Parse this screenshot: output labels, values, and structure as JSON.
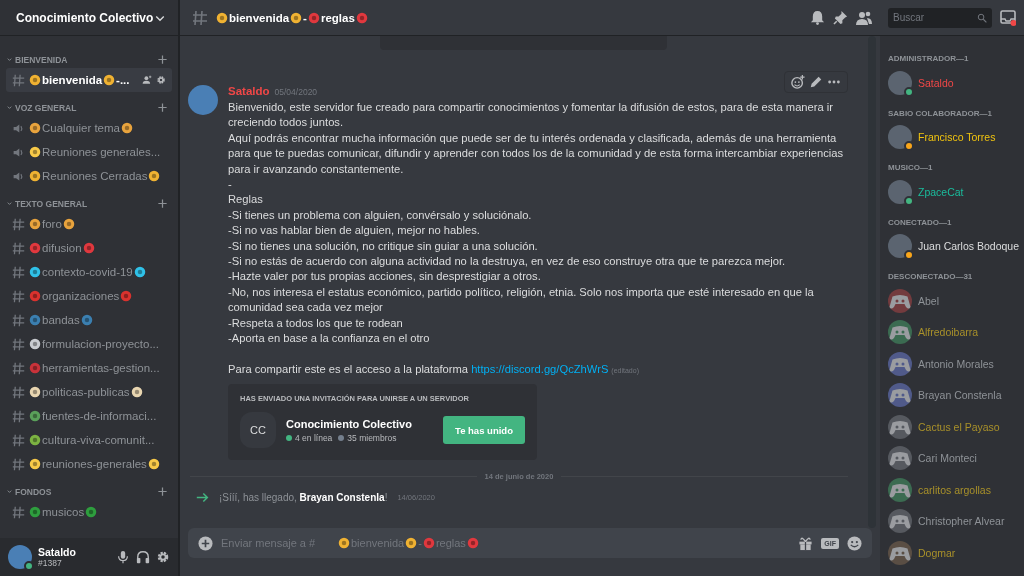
{
  "server": {
    "name": "Conocimiento Colectivo"
  },
  "categories": [
    {
      "name": "BIENVENIDA",
      "channels": [
        {
          "kind": "text",
          "selected": true,
          "settings": true,
          "parts": [
            {
              "kind": "emoji",
              "color": "#f0b232"
            },
            {
              "kind": "text",
              "text": "bienvenida"
            },
            {
              "kind": "emoji",
              "color": "#f0b232"
            },
            {
              "kind": "text",
              "text": "-..."
            }
          ]
        }
      ]
    },
    {
      "name": "VOZ GENERAL",
      "channels": [
        {
          "kind": "voice",
          "selected": false,
          "parts": [
            {
              "kind": "emoji",
              "color": "#e8a33d"
            },
            {
              "kind": "text",
              "text": "Cualquier tema"
            },
            {
              "kind": "emoji",
              "color": "#e8a33d"
            }
          ]
        },
        {
          "kind": "voice",
          "selected": false,
          "parts": [
            {
              "kind": "emoji",
              "color": "#f7c948"
            },
            {
              "kind": "text",
              "text": "Reuniones generales..."
            }
          ]
        },
        {
          "kind": "voice",
          "selected": false,
          "parts": [
            {
              "kind": "emoji",
              "color": "#f0b232"
            },
            {
              "kind": "text",
              "text": "Reuniones Cerradas"
            },
            {
              "kind": "emoji",
              "color": "#f0b232"
            }
          ]
        }
      ]
    },
    {
      "name": "TEXTO GENERAL",
      "channels": [
        {
          "kind": "text",
          "selected": false,
          "parts": [
            {
              "kind": "emoji",
              "color": "#e8a33d"
            },
            {
              "kind": "text",
              "text": "foro"
            },
            {
              "kind": "emoji",
              "color": "#e8a33d"
            }
          ]
        },
        {
          "kind": "text",
          "selected": false,
          "parts": [
            {
              "kind": "emoji",
              "color": "#e0383e"
            },
            {
              "kind": "text",
              "text": "difusion"
            },
            {
              "kind": "emoji",
              "color": "#e0383e"
            }
          ]
        },
        {
          "kind": "text",
          "selected": false,
          "parts": [
            {
              "kind": "emoji",
              "color": "#2fc1e8"
            },
            {
              "kind": "text",
              "text": "contexto-covid-19"
            },
            {
              "kind": "emoji",
              "color": "#2fc1e8"
            }
          ]
        },
        {
          "kind": "text",
          "selected": false,
          "parts": [
            {
              "kind": "emoji",
              "color": "#d9322e"
            },
            {
              "kind": "text",
              "text": "organizaciones"
            },
            {
              "kind": "emoji",
              "color": "#d9322e"
            }
          ]
        },
        {
          "kind": "text",
          "selected": false,
          "parts": [
            {
              "kind": "emoji",
              "color": "#3b7fb0"
            },
            {
              "kind": "text",
              "text": "bandas"
            },
            {
              "kind": "emoji",
              "color": "#3b7fb0"
            }
          ]
        },
        {
          "kind": "text",
          "selected": false,
          "parts": [
            {
              "kind": "emoji",
              "color": "#c9ccd1"
            },
            {
              "kind": "text",
              "text": "formulacion-proyecto..."
            }
          ]
        },
        {
          "kind": "text",
          "selected": false,
          "parts": [
            {
              "kind": "emoji",
              "color": "#c8323a"
            },
            {
              "kind": "text",
              "text": "herramientas-gestion..."
            }
          ]
        },
        {
          "kind": "text",
          "selected": false,
          "parts": [
            {
              "kind": "emoji",
              "color": "#e8d5b0"
            },
            {
              "kind": "text",
              "text": "politicas-publicas"
            },
            {
              "kind": "emoji",
              "color": "#e8d5b0"
            }
          ]
        },
        {
          "kind": "text",
          "selected": false,
          "parts": [
            {
              "kind": "emoji",
              "color": "#5aa05a"
            },
            {
              "kind": "text",
              "text": "fuentes-de-informaci..."
            }
          ]
        },
        {
          "kind": "text",
          "selected": false,
          "parts": [
            {
              "kind": "emoji",
              "color": "#7cb342"
            },
            {
              "kind": "text",
              "text": "cultura-viva-comunit..."
            }
          ]
        },
        {
          "kind": "text",
          "selected": false,
          "parts": [
            {
              "kind": "emoji",
              "color": "#f7c948"
            },
            {
              "kind": "text",
              "text": "reuniones-generales"
            },
            {
              "kind": "emoji",
              "color": "#f7c948"
            }
          ]
        }
      ]
    },
    {
      "name": "FONDOS",
      "channels": [
        {
          "kind": "text",
          "selected": false,
          "parts": [
            {
              "kind": "emoji",
              "color": "#2e9e3e"
            },
            {
              "kind": "text",
              "text": "musicos"
            },
            {
              "kind": "emoji",
              "color": "#2e9e3e"
            }
          ]
        }
      ]
    }
  ],
  "user_panel": {
    "name": "Sataldo",
    "tag": "#1387",
    "online": true
  },
  "topbar": {
    "title_parts": [
      {
        "kind": "emoji",
        "color": "#f0b232"
      },
      {
        "kind": "text",
        "text": "bienvenida"
      },
      {
        "kind": "emoji",
        "color": "#f0b232"
      },
      {
        "kind": "text",
        "text": "-"
      },
      {
        "kind": "emoji",
        "color": "#e0383e"
      },
      {
        "kind": "text",
        "text": "reglas"
      },
      {
        "kind": "emoji",
        "color": "#e0383e"
      }
    ],
    "search": {
      "placeholder": "Buscar"
    }
  },
  "message": {
    "author": "Sataldo",
    "date": "05/04/2020",
    "lines": [
      {
        "text": "Bienvenido, este servidor fue creado para compartir conocimientos y fomentar la difusión de estos, para de esta manera ir creciendo todos juntos."
      },
      {
        "text": "Aquí podrás encontrar mucha información que puede ser de tu interés ordenada y clasificada, además de una herramienta para que te puedas comunicar, difundir y aprender con todos los de la comunidad y de esta forma intercambiar  experiencias para ir avanzando constantemente."
      },
      {
        "text": "-"
      },
      {
        "text": "Reglas"
      },
      {
        "text": "-Si tienes un problema con alguien, convérsalo y soluciónalo."
      },
      {
        "text": "-Si no vas hablar bien de alguien, mejor no hables."
      },
      {
        "text": "-Si no tienes una solución, no critique sin guiar a una solución."
      },
      {
        "text": "-Si no estás de acuerdo con alguna actividad no la destruya, en vez de eso construye otra que te parezca mejor."
      },
      {
        "text": "-Hazte valer por tus propias acciones, sin desprestigiar a otros."
      },
      {
        "text": "-No, nos interesa el estatus económico, partido político, religión, etnia.  Solo nos importa que esté interesado en que la comunidad sea cada vez mejor"
      },
      {
        "text": "-Respeta a todos los que te rodean"
      },
      {
        "text": "-Aporta en base a la confianza en el otro"
      },
      {
        "text": "Para compartir este es el acceso a la plataforma",
        "link": "https://discord.gg/QcZhWrS",
        "edited": "(editado)",
        "gap_before": true
      }
    ],
    "invite": {
      "heading": "HAS ENVIADO UNA INVITACIÓN PARA UNIRSE A UN SERVIDOR",
      "initials": "CC",
      "server": "Conocimiento Colectivo",
      "online": "4 en línea",
      "members": "35 miembros",
      "button": "Te has unido"
    }
  },
  "divider": {
    "date": "14 de junio de 2020"
  },
  "join": {
    "text": "¡Sííí, has llegado, **Brayan Constenla**!",
    "date": "14/06/2020"
  },
  "composer": {
    "placeholder": "Enviar mensaje a #",
    "rest_parts": [
      {
        "kind": "emoji",
        "color": "#f0b232"
      },
      {
        "kind": "text",
        "text": "bienvenida"
      },
      {
        "kind": "emoji",
        "color": "#f0b232"
      },
      {
        "kind": "text",
        "text": "-"
      },
      {
        "kind": "emoji",
        "color": "#e0383e"
      },
      {
        "kind": "text",
        "text": "reglas"
      },
      {
        "kind": "emoji",
        "color": "#e0383e"
      }
    ],
    "gif": "GIF"
  },
  "member_groups": [
    {
      "title": "ADMINISTRADOR—1",
      "members": [
        {
          "name": "Sataldo",
          "color": "#f04747",
          "kind": "online"
        }
      ]
    },
    {
      "title": "SABIO COLABORADOR—1",
      "members": [
        {
          "name": "Francisco Torres",
          "color": "#f1c40f",
          "kind": "idle"
        }
      ]
    },
    {
      "title": "MUSICO—1",
      "members": [
        {
          "name": "ZpaceCat",
          "color": "#1abc9c",
          "kind": "online"
        }
      ]
    },
    {
      "title": "CONECTADO—1",
      "members": [
        {
          "name": "Juan Carlos Bodoque",
          "color": "#dcddde",
          "kind": "idle"
        }
      ]
    },
    {
      "title": "DESCONECTADO—31",
      "members": [
        {
          "name": "Abel",
          "color": "#8e9297",
          "kind": "offline",
          "avatar": {
            "color": "#733b3e"
          }
        },
        {
          "name": "Alfredoibarra",
          "color": "#a8902a",
          "kind": "offline",
          "avatar": {
            "color": "#3b6b51"
          }
        },
        {
          "name": "Antonio Morales",
          "color": "#8e9297",
          "kind": "offline",
          "avatar": {
            "color": "#505a8a"
          }
        },
        {
          "name": "Brayan Constenla",
          "color": "#8e9297",
          "kind": "offline",
          "avatar": {
            "color": "#505a8a"
          }
        },
        {
          "name": "Cactus el Payaso",
          "color": "#a8902a",
          "kind": "offline",
          "avatar": {
            "color": "#56595f"
          }
        },
        {
          "name": "Cari Monteci",
          "color": "#8e9297",
          "kind": "offline",
          "avatar": {
            "color": "#56595f"
          }
        },
        {
          "name": "carlitos argollas",
          "color": "#a8902a",
          "kind": "offline",
          "avatar": {
            "color": "#3b6b51"
          }
        },
        {
          "name": "Christopher Alvear",
          "color": "#8e9297",
          "kind": "offline",
          "avatar": {
            "color": "#56595f"
          }
        },
        {
          "name": "Dogmar",
          "color": "#a8902a",
          "kind": "offline",
          "avatar": {
            "color": "#5a4e44"
          }
        }
      ]
    }
  ]
}
